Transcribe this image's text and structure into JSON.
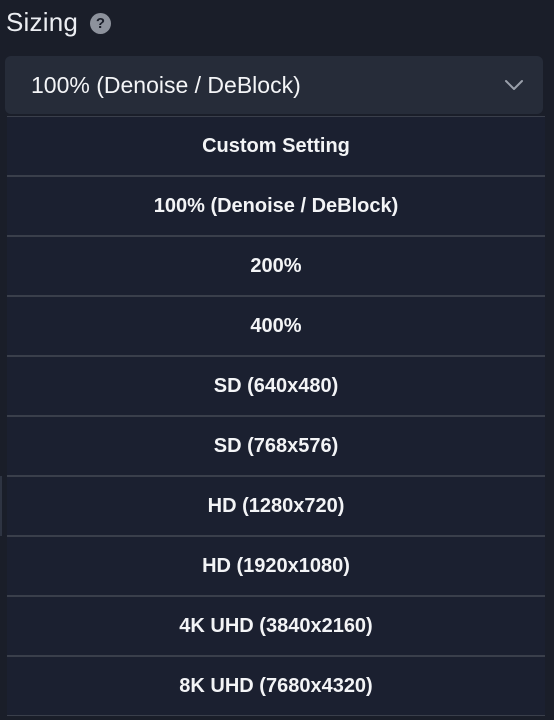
{
  "section": {
    "title": "Sizing",
    "help_icon": "question-circle-icon"
  },
  "select": {
    "value": "100% (Denoise / DeBlock)",
    "chevron_icon": "chevron-down-icon"
  },
  "options": [
    "Custom Setting",
    "100% (Denoise / DeBlock)",
    "200%",
    "400%",
    "SD (640x480)",
    "SD (768x576)",
    "HD (1280x720)",
    "HD (1920x1080)",
    "4K UHD (3840x2160)",
    "8K UHD (7680x4320)"
  ],
  "colors": {
    "background": "#1a1e29",
    "select_bg": "#262c39",
    "option_bg": "#1b2030",
    "divider": "#3a3f4b",
    "help_icon": "#8d929c"
  }
}
